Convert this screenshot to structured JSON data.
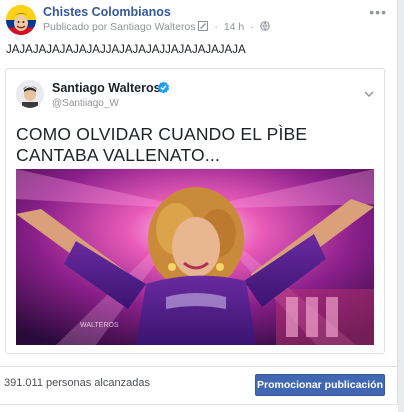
{
  "post": {
    "page_name": "Chistes Colombianos",
    "published_by": "Publicado por Santiago Walteros",
    "time": "14 h",
    "status_text": "JAJAJAJAJAJAJAJJAJAJAJAJJAJAJAJAJAJA"
  },
  "tweet": {
    "author_name": "Santiago Walteros",
    "handle": "@Santiiago_W",
    "text": "COMO OLVIDAR CUANDO EL PÌBE CANTABA VALLENATO...",
    "image_watermark": "WALTEROS"
  },
  "footer": {
    "reach": "391.011 personas alcanzadas",
    "promote_label": "Promocionar publicación"
  },
  "colors": {
    "link_blue": "#365899",
    "button_blue": "#4267b2",
    "verified_blue": "#1da1f2"
  },
  "icons": [
    "page-avatar",
    "editor-icon",
    "more-options-icon",
    "verified-icon",
    "chevron-down-icon"
  ]
}
